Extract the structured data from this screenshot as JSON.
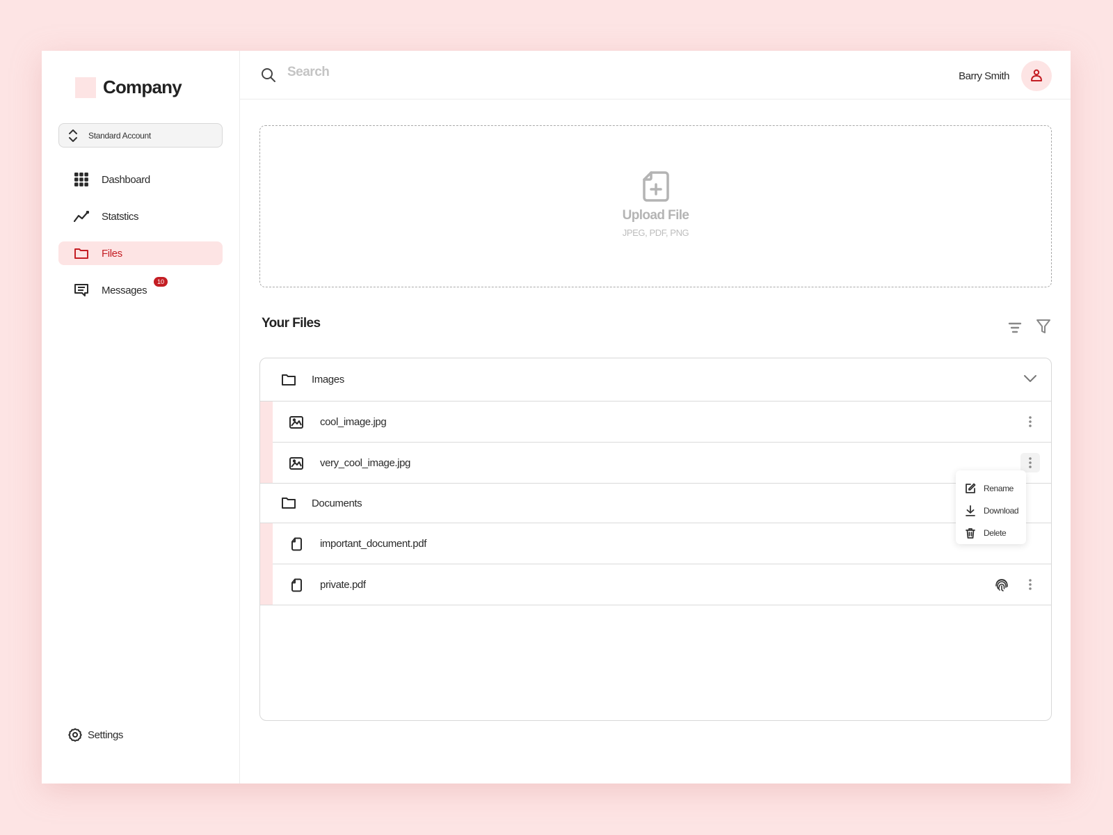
{
  "brand": {
    "name": "Company",
    "accent": "#c41e24",
    "tint": "#fde4e4"
  },
  "account": {
    "label": "Standard Account"
  },
  "nav": {
    "items": [
      {
        "label": "Dashboard",
        "icon": "grid-icon",
        "active": false
      },
      {
        "label": "Statstics",
        "icon": "chart-line-icon",
        "active": false
      },
      {
        "label": "Files",
        "icon": "folder-icon",
        "active": true
      },
      {
        "label": "Messages",
        "icon": "message-icon",
        "active": false,
        "badge": "10"
      }
    ],
    "settings_label": "Settings"
  },
  "topbar": {
    "search_placeholder": "Search",
    "search_value": "",
    "user_name": "Barry Smith"
  },
  "upload": {
    "title": "Upload File",
    "formats": "JPEG, PDF, PNG"
  },
  "files": {
    "heading": "Your Files",
    "groups": [
      {
        "name": "Images",
        "expanded": true,
        "files": [
          {
            "name": "cool_image.jpg",
            "type": "image"
          },
          {
            "name": "very_cool_image.jpg",
            "type": "image",
            "menu_open": true
          }
        ]
      },
      {
        "name": "Documents",
        "files": [
          {
            "name": "important_document.pdf",
            "type": "document"
          },
          {
            "name": "private.pdf",
            "type": "document",
            "protected": true
          }
        ]
      }
    ]
  },
  "context_menu": {
    "items": [
      {
        "label": "Rename",
        "icon": "edit-icon"
      },
      {
        "label": "Download",
        "icon": "download-icon"
      },
      {
        "label": "Delete",
        "icon": "trash-icon"
      }
    ]
  }
}
